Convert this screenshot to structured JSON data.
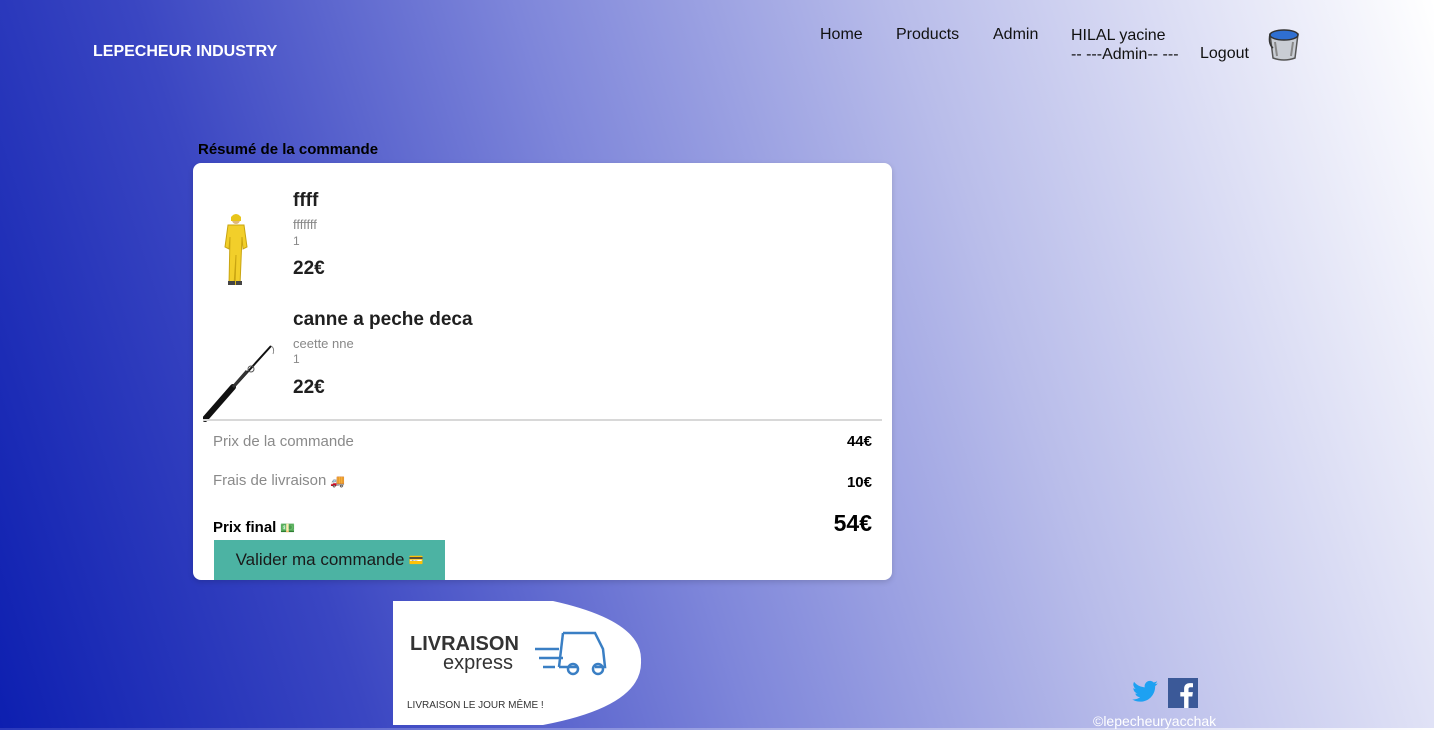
{
  "header": {
    "brand": "LEPECHEUR INDUSTRY",
    "nav": {
      "home": "Home",
      "products": "Products",
      "admin": "Admin"
    },
    "user": {
      "name": "HILAL yacine",
      "role": "-- ---Admin-- ---"
    },
    "logout": "Logout",
    "cart_icon": "bucket-icon"
  },
  "summary": {
    "title": "Résumé de la commande",
    "items": [
      {
        "name": "ffff",
        "description": "fffffff",
        "quantity": "1",
        "price": "22€",
        "image": "raincoat-image"
      },
      {
        "name": "canne a peche deca",
        "description": "ceette nne",
        "quantity": "1",
        "price": "22€",
        "image": "fishing-rod-image"
      }
    ],
    "order_price_label": "Prix de la commande",
    "order_price_value": "44€",
    "shipping_label": "Frais de livraison",
    "shipping_emoji": "🚚",
    "shipping_value": "10€",
    "final_label": "Prix final",
    "final_emoji": "💵",
    "final_value": "54€",
    "validate_label": "Valider ma commande",
    "validate_emoji": "💳"
  },
  "delivery_badge": {
    "title": "LIVRAISON",
    "subtitle": "express",
    "tagline": "LIVRAISON LE JOUR MÊME !"
  },
  "footer": {
    "copyright": "©lepecheuryacchak"
  },
  "colors": {
    "accent": "#4cb3a3",
    "twitter": "#1da1f2",
    "facebook": "#3b5998",
    "truck": "#3a7fc4"
  }
}
